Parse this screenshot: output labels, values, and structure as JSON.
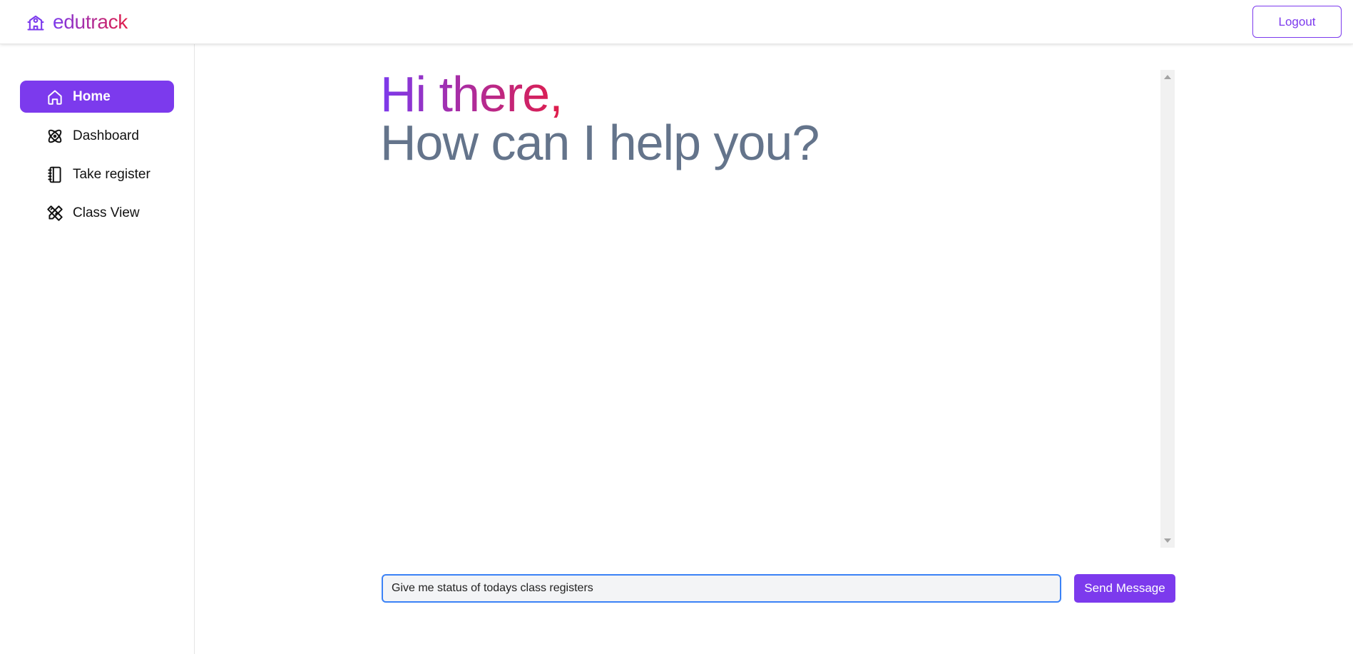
{
  "header": {
    "brand": "edutrack",
    "brand_icon": "school-icon",
    "logout_label": "Logout"
  },
  "sidebar": {
    "items": [
      {
        "label": "Home",
        "icon": "home-icon",
        "active": true
      },
      {
        "label": "Dashboard",
        "icon": "atom-icon",
        "active": false
      },
      {
        "label": "Take register",
        "icon": "notebook-icon",
        "active": false
      },
      {
        "label": "Class View",
        "icon": "pencil-ruler-icon",
        "active": false
      }
    ]
  },
  "main": {
    "greeting_line1": "Hi there,",
    "greeting_line2": "How can I help you?"
  },
  "chat": {
    "input_value": "Give me status of todays class registers",
    "send_label": "Send Message"
  },
  "colors": {
    "accent": "#7c3aed",
    "gradient_end": "#e11d48",
    "subtitle": "#64748b",
    "focus_border": "#3b82f6"
  }
}
